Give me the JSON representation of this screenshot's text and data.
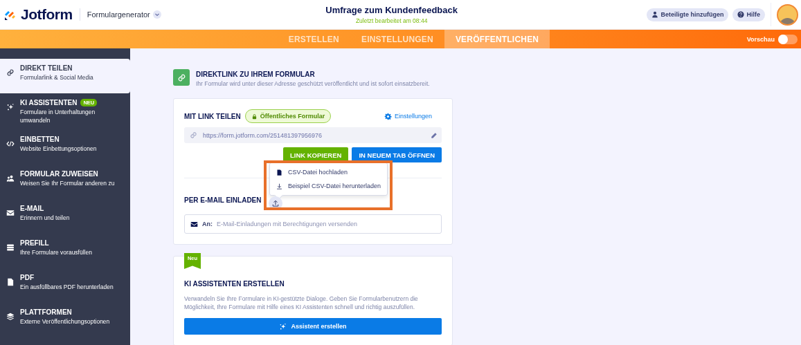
{
  "header": {
    "logo": "Jotform",
    "product": "Formulargenerator",
    "form_title": "Umfrage zum Kundenfeedback",
    "last_edited": "Zuletzt bearbeitet am 08:44",
    "buttons": [
      {
        "label": "Beteiligte hinzufügen",
        "kind": "people"
      },
      {
        "label": "Hilfe",
        "kind": "help"
      }
    ]
  },
  "nav": {
    "tabs": [
      {
        "label": "ERSTELLEN",
        "selected": false
      },
      {
        "label": "EINSTELLUNGEN",
        "selected": false
      },
      {
        "label": "VERÖFFENTLICHEN",
        "selected": true
      }
    ],
    "preview": {
      "label": "Vorschau",
      "on": false
    }
  },
  "sidebar": {
    "items": [
      {
        "title": "DIREKT TEILEN",
        "subtitle": "Formularlink & Social Media",
        "selected": true
      },
      {
        "title": "KI ASSISTENTEN",
        "badge": "NEU",
        "subtitle": "Formulare in Unterhaltungen umwandeln",
        "selected": false
      },
      {
        "title": "EINBETTEN",
        "subtitle": "Website Einbettungsoptionen",
        "selected": false
      },
      {
        "title": "FORMULAR ZUWEISEN",
        "subtitle": "Weisen Sie Ihr Formular anderen zu",
        "selected": false
      },
      {
        "title": "E-MAIL",
        "subtitle": "Erinnern und teilen",
        "selected": false
      },
      {
        "title": "PREFILL",
        "subtitle": "Ihre Formulare vorausfüllen",
        "selected": false
      },
      {
        "title": "PDF",
        "subtitle": "Ein ausfüllbares PDF herunterladen",
        "selected": false
      },
      {
        "title": "PLATTFORMEN",
        "subtitle": "Externe Veröffentlichungsoptionen",
        "selected": false
      }
    ]
  },
  "direct_link": {
    "title": "DIREKTLINK ZU IHREM FORMULAR",
    "description": "Ihr Formular wird unter dieser Adresse geschützt veröffentlicht und ist sofort einsatzbereit.",
    "share": {
      "heading": "MIT LINK TEILEN",
      "access": "Öffentliches Formular",
      "settings": "Einstellungen",
      "url": "https://form.jotform.com/251481397956976",
      "buttons": [
        {
          "label": "LINK KOPIEREN",
          "kind": "copy"
        },
        {
          "label": "IN NEUEM TAB ÖFFNEN",
          "kind": "open"
        }
      ]
    },
    "upload_menu": {
      "items": [
        {
          "label": "CSV-Datei hochladen",
          "kind": "file"
        },
        {
          "label": "Beispiel CSV-Datei herunterladen",
          "kind": "download"
        }
      ]
    },
    "email": {
      "heading": "PER E-MAIL EINLADEN",
      "to_label": "An:",
      "placeholder": "E-Mail-Einladungen mit Berechtigungen versenden"
    }
  },
  "ai_card": {
    "ribbon": "Neu",
    "title": "KI ASSISTENTEN ERSTELLEN",
    "description": "Verwandeln Sie Ihre Formulare in KI-gestützte Dialoge. Geben Sie Formularbenutzern die Möglichkeit, Ihre Formulare mit Hilfe eines KI Assistenten schnell und richtig auszufüllen.",
    "button": "Assistent erstellen"
  }
}
